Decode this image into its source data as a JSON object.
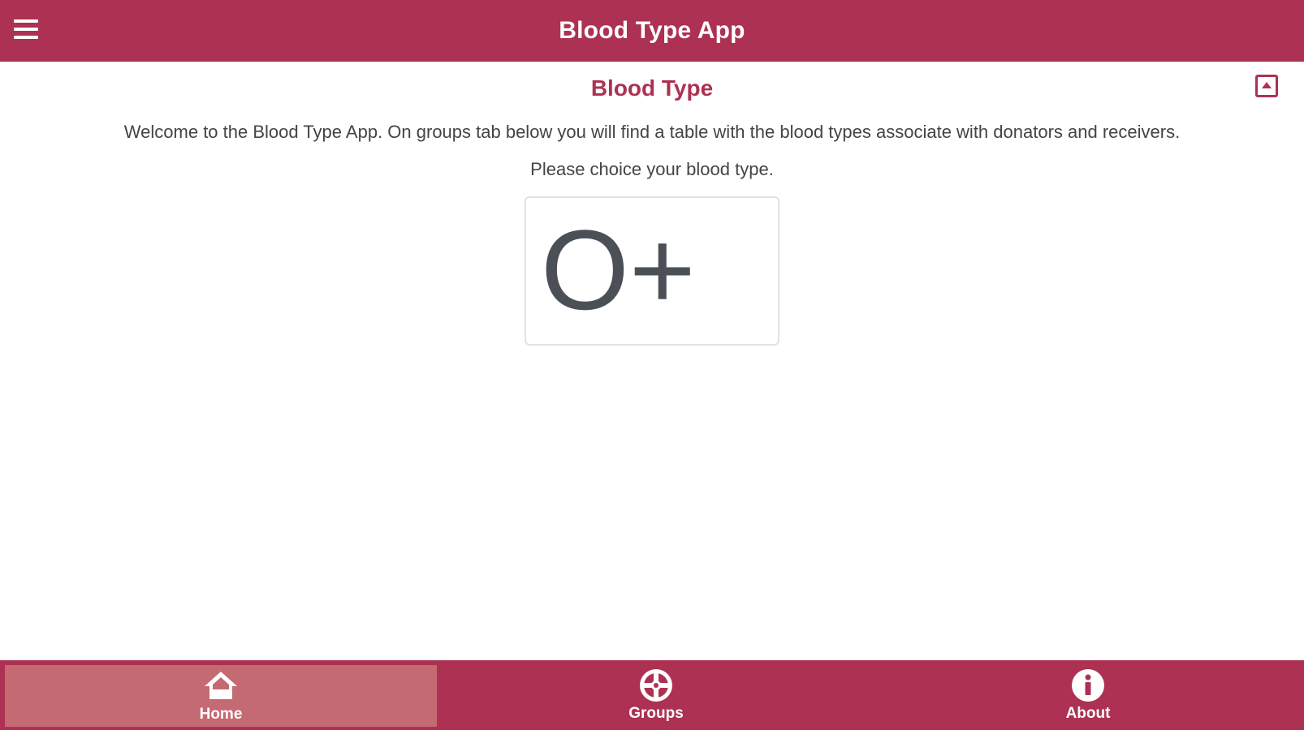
{
  "header": {
    "title": "Blood Type App",
    "menu_icon": "hamburger-menu-icon"
  },
  "section": {
    "title": "Blood Type",
    "collapse_icon": "collapse-up-icon"
  },
  "content": {
    "intro": "Welcome to the Blood Type App. On groups tab below you will find a table with the blood types associate with donators and receivers.",
    "prompt": "Please choice your blood type.",
    "selected_blood_type": "O+"
  },
  "tabs": [
    {
      "label": "Home",
      "icon": "home-icon",
      "active": true
    },
    {
      "label": "Groups",
      "icon": "groups-icon",
      "active": false
    },
    {
      "label": "About",
      "icon": "info-icon",
      "active": false
    }
  ],
  "colors": {
    "brand": "#ad3152",
    "active_tab": "#c46a72",
    "text": "#444444",
    "value_text": "#4b4f56"
  }
}
